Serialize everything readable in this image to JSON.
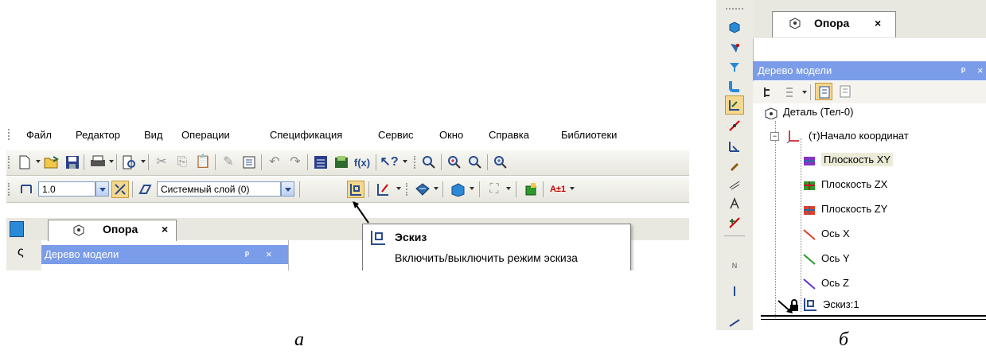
{
  "menu": {
    "items": [
      {
        "label": "Файл"
      },
      {
        "label": "Редактор"
      },
      {
        "label": "Вид"
      },
      {
        "label": "Операции"
      },
      {
        "label": "Спецификация"
      },
      {
        "label": "Сервис"
      },
      {
        "label": "Окно"
      },
      {
        "label": "Справка"
      },
      {
        "label": "Библиотеки"
      }
    ]
  },
  "toolbar2": {
    "scale_value": "1.0",
    "layer_value": "Системный слой (0)"
  },
  "document_tab": {
    "label": "Опора",
    "close": "×"
  },
  "tree_panel": {
    "title": "Дерево модели",
    "pin": "ᵖ",
    "close": "×"
  },
  "tooltip": {
    "title": "Эскиз",
    "description": "Включить/выключить режим эскиза"
  },
  "model_tree": {
    "root": "Деталь (Тел-0)",
    "origin": "(т)Начало координат",
    "items": [
      {
        "label": "Плоскость XY",
        "selected": true
      },
      {
        "label": "Плоскость ZX"
      },
      {
        "label": "Плоскость ZY"
      },
      {
        "label": "Ось X"
      },
      {
        "label": "Ось Y"
      },
      {
        "label": "Ось Z"
      }
    ],
    "sketch": "Эскиз:1"
  },
  "captions": {
    "a": "а",
    "b": "б"
  },
  "colors": {
    "header_blue": "#7b9ce8",
    "selected_bg": "#ecebd8",
    "pressed": "#f5d88f"
  }
}
